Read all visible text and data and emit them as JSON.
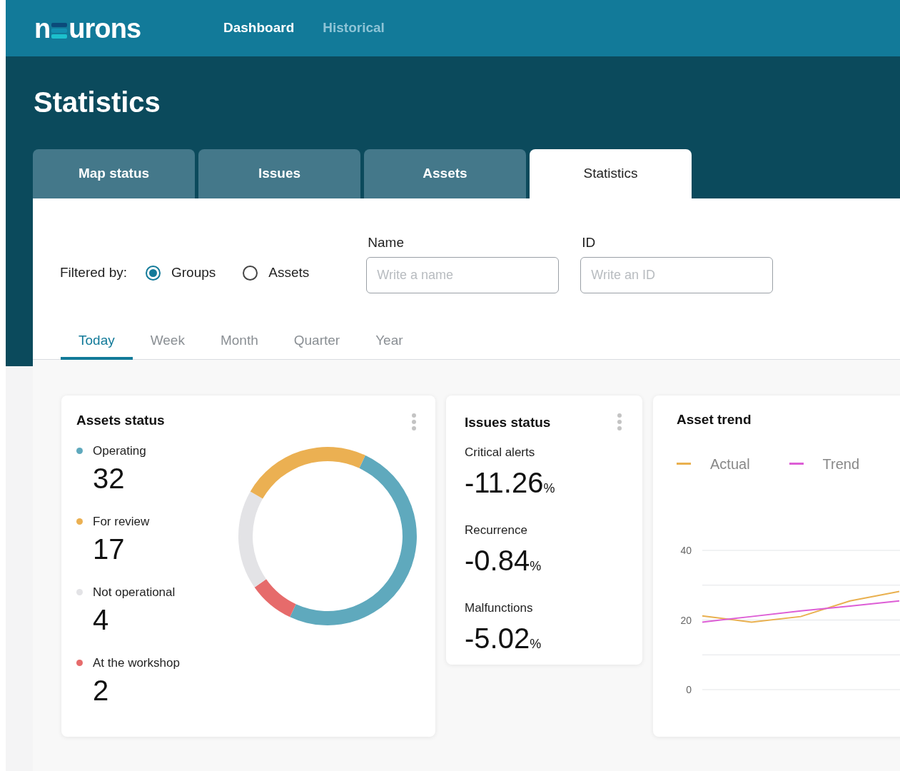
{
  "header": {
    "logo": {
      "start": "n",
      "end": "urons"
    },
    "nav": [
      {
        "label": "Dashboard",
        "selected": true
      },
      {
        "label": "Historical",
        "selected": false
      }
    ]
  },
  "page_title": "Statistics",
  "tabs": [
    {
      "label": "Map status",
      "selected": false
    },
    {
      "label": "Issues",
      "selected": false
    },
    {
      "label": "Assets",
      "selected": false
    },
    {
      "label": "Statistics",
      "selected": true
    }
  ],
  "filters": {
    "label": "Filtered by:",
    "options": [
      {
        "label": "Groups",
        "selected": true
      },
      {
        "label": "Assets",
        "selected": false
      }
    ],
    "fields": [
      {
        "label": "Name",
        "placeholder": "Write a name"
      },
      {
        "label": "ID",
        "placeholder": "Write an ID"
      }
    ]
  },
  "periods": [
    {
      "label": "Today",
      "selected": true
    },
    {
      "label": "Week",
      "selected": false
    },
    {
      "label": "Month",
      "selected": false
    },
    {
      "label": "Quarter",
      "selected": false
    },
    {
      "label": "Year",
      "selected": false
    }
  ],
  "assets_status": {
    "title": "Assets status",
    "items": [
      {
        "label": "Operating",
        "value": "32",
        "color": "#5fa9bd"
      },
      {
        "label": "For review",
        "value": "17",
        "color": "#ebb052"
      },
      {
        "label": "Not operational",
        "value": "4",
        "color": "#e3e3e6"
      },
      {
        "label": "At the workshop",
        "value": "2",
        "color": "#e66b6b"
      }
    ]
  },
  "issues_status": {
    "title": "Issues status",
    "metrics": [
      {
        "label": "Critical alerts",
        "value": "-11.26",
        "unit": "%"
      },
      {
        "label": "Recurrence",
        "value": "-0.84",
        "unit": "%"
      },
      {
        "label": "Malfunctions",
        "value": "-5.02",
        "unit": "%"
      }
    ]
  },
  "asset_trend": {
    "title": "Asset trend",
    "chart_data": {
      "type": "line",
      "ylim": [
        0,
        40
      ],
      "yticks": [
        0,
        20,
        40
      ],
      "series": [
        {
          "name": "Actual",
          "color": "#e9b04f",
          "values": [
            21.2,
            19.4,
            21,
            25.5,
            28.2
          ]
        },
        {
          "name": "Trend",
          "color": "#dd5ed6",
          "values": [
            19.4,
            21,
            22.6,
            24,
            25.5
          ]
        }
      ]
    }
  }
}
